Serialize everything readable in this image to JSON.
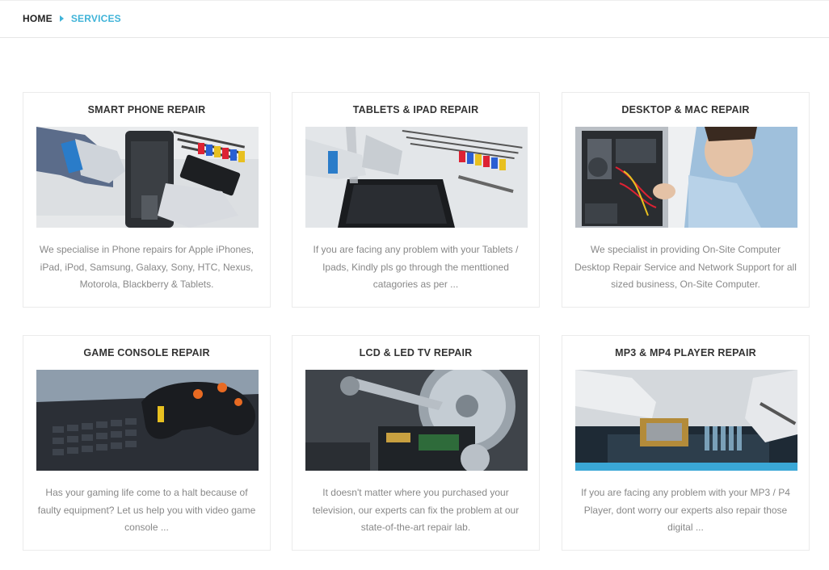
{
  "breadcrumb": {
    "home": "HOME",
    "current": "SERVICES"
  },
  "accent_color": "#3fb3d8",
  "services": [
    {
      "title": "SMART PHONE REPAIR",
      "image_icon": "smartphone-repair-photo",
      "text": "We specialise in Phone repairs for Apple iPhones, iPad, iPod, Samsung, Galaxy, Sony, HTC, Nexus, Motorola, Blackberry & Tablets."
    },
    {
      "title": "TABLETS & IPAD REPAIR",
      "image_icon": "tablet-repair-photo",
      "text": "If you are facing any problem with your Tablets / Ipads, Kindly pls go through the menttioned catagories as per ..."
    },
    {
      "title": "DESKTOP & MAC REPAIR",
      "image_icon": "desktop-repair-photo",
      "text": "We specialist in providing On-Site Computer Desktop Repair Service and Network Support for all sized business, On-Site Computer."
    },
    {
      "title": "GAME CONSOLE REPAIR",
      "image_icon": "game-console-photo",
      "text": "Has your gaming life come to a halt because of faulty equipment? Let us help you with video game console ..."
    },
    {
      "title": "LCD & LED TV REPAIR",
      "image_icon": "hard-drive-photo",
      "text": "It doesn't matter where you purchased your television, our experts can fix the problem at our state-of-the-art repair lab."
    },
    {
      "title": "MP3 & MP4 PLAYER REPAIR",
      "image_icon": "circuit-board-photo",
      "text": "If you are facing any problem with your MP3 / P4 Player, dont worry our experts also repair those digital ..."
    }
  ]
}
